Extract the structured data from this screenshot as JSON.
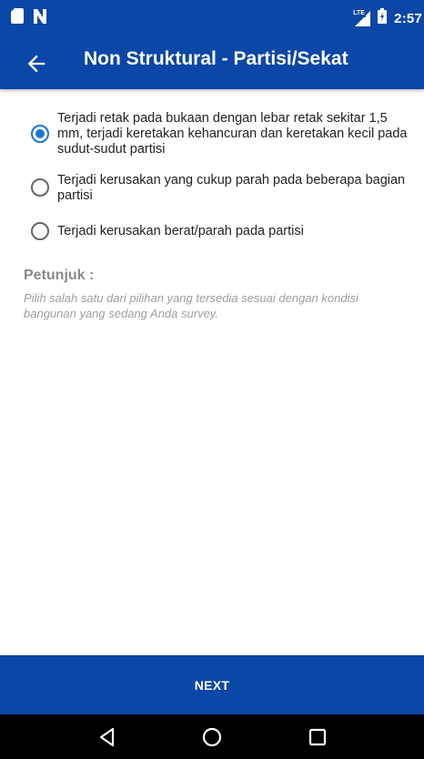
{
  "status_bar": {
    "time": "2:57",
    "network_label": "LTE",
    "icons": [
      "sim-card-icon",
      "n-notification-icon",
      "lte-signal-icon",
      "battery-icon"
    ]
  },
  "app_bar": {
    "title": "Non Struktural - Partisi/Sekat",
    "back_icon": "arrow-back-icon"
  },
  "options": [
    {
      "label": "Terjadi retak pada bukaan dengan lebar retak sekitar 1,5 mm, terjadi keretakan kehancuran dan keretakan kecil pada sudut-sudut partisi",
      "selected": true
    },
    {
      "label": "Terjadi kerusakan yang cukup parah pada beberapa bagian partisi",
      "selected": false
    },
    {
      "label": "Terjadi kerusakan berat/parah pada partisi",
      "selected": false
    }
  ],
  "hint": {
    "title": "Petunjuk :",
    "text": "Pilih salah satu dari pilihan yang tersedia sesuai dengan kondisi bangunan yang sedang Anda survey."
  },
  "footer": {
    "next_label": "NEXT"
  },
  "nav": {
    "icons": [
      "back-triangle-icon",
      "home-circle-icon",
      "recents-square-icon"
    ]
  },
  "colors": {
    "primary": "#0b47a6",
    "accent": "#1976d2",
    "hint": "#9e9e9e"
  }
}
